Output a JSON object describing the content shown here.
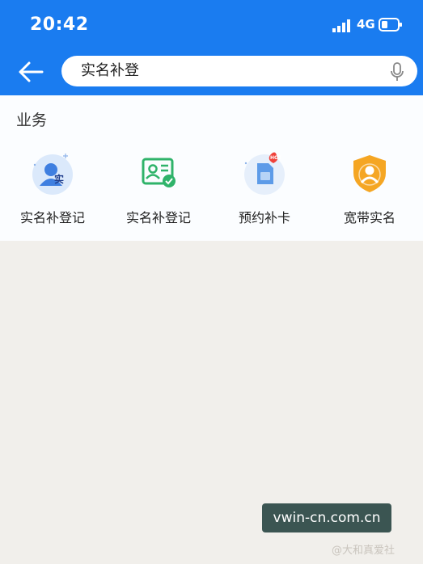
{
  "status_bar": {
    "time": "20:42",
    "network": "4G",
    "icons": [
      "signal-icon",
      "battery-icon"
    ]
  },
  "header": {
    "back_icon": "back-arrow-icon",
    "search": {
      "value": "实名补登",
      "icon": "mic-icon"
    }
  },
  "business": {
    "title": "业务",
    "items": [
      {
        "label": "实名补登记",
        "icon": "person-real-name-icon",
        "badge": "实"
      },
      {
        "label": "实名补登记",
        "icon": "id-card-check-icon"
      },
      {
        "label": "预约补卡",
        "icon": "sim-card-icon",
        "badge": "HOT"
      },
      {
        "label": "宽带实名",
        "icon": "shield-user-icon"
      }
    ]
  },
  "watermark": {
    "banner": "vwin-cn.com.cn",
    "caption": "@大和真爱社"
  },
  "colors": {
    "header_blue": "#1a7cf0",
    "page_bg": "#f1efeb",
    "section_bg": "#fbfdff",
    "green": "#2fb36a",
    "orange": "#f5a623"
  }
}
